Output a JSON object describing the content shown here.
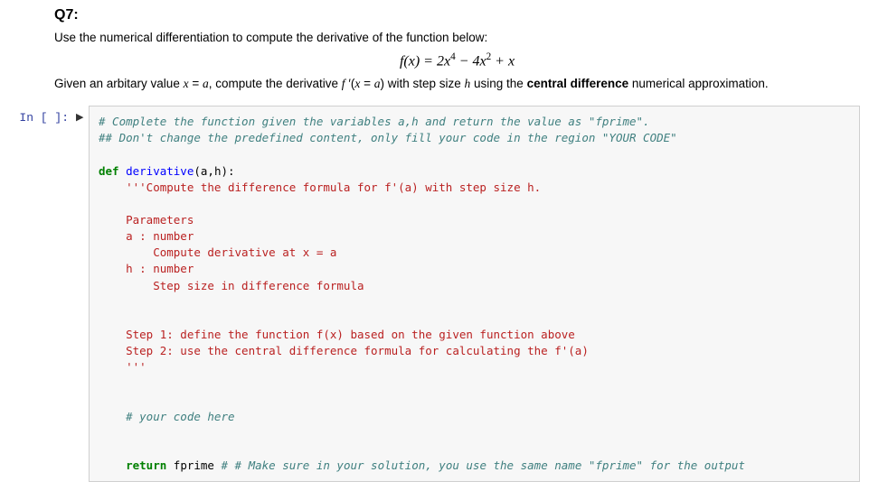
{
  "markdown": {
    "title": "Q7:",
    "line1": "Use the numerical differentiation to compute the derivative of the function below:",
    "formula_html": "<span class='serif-i'>f</span>(<span class='serif-i'>x</span>) = 2<span class='serif-i'>x</span><span class='sup'>4</span> − 4<span class='serif-i'>x</span><span class='sup'>2</span> + <span class='serif-i'>x</span>",
    "line2_html": "Given an arbitary value <span class='serif-i'>x</span> = <span class='serif-i'>a</span>, compute the derivative <span class='serif-i'>f</span> ′(<span class='serif-i'>x</span> = <span class='serif-i'>a</span>) with step size <span class='serif-i'>h</span> using the <b>central difference</b> numerical approximation."
  },
  "cell": {
    "prompt": "In [ ]:",
    "caret": "▶",
    "code": {
      "c1": "# Complete the function given the variables a,h and return the value as \"fprime\".",
      "c2": "## Don't change the predefined content, only fill your code in the region \"YOUR CODE\"",
      "blank": "",
      "def_kw": "def",
      "def_name": " derivative",
      "def_rest": "(a,h):",
      "doc1": "    '''Compute the difference formula for f'(a) with step size h.",
      "doc3": "    Parameters",
      "doc4": "    a : number",
      "doc5": "        Compute derivative at x = a",
      "doc6": "    h : number",
      "doc7": "        Step size in difference formula",
      "doc9": "    Step 1: define the function f(x) based on the given function above",
      "doc10": "    Step 2: use the central difference formula for calculating the f'(a)",
      "doc11": "    '''",
      "yc": "    # your code here",
      "ret_indent": "    ",
      "ret_kw": "return",
      "ret_var": " fprime ",
      "ret_cm": "# # Make sure in your solution, you use the same name \"fprime\" for the output"
    }
  }
}
